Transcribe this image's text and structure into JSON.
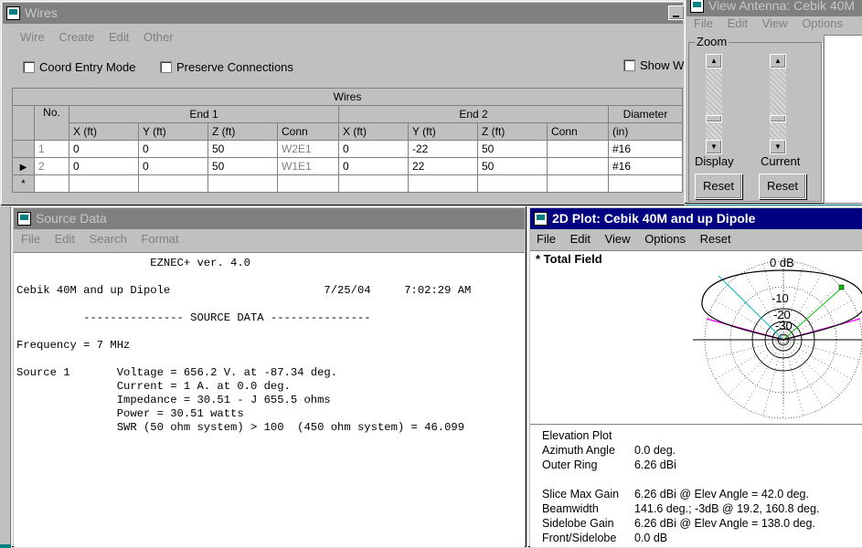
{
  "wires_window": {
    "title": "Wires",
    "menu": [
      "Wire",
      "Create",
      "Edit",
      "Other"
    ],
    "coord_entry_mode": "Coord Entry Mode",
    "preserve_connections": "Preserve Connections",
    "show_wires": "Show W",
    "table": {
      "caption": "Wires",
      "no_header": "No.",
      "end1_header": "End 1",
      "end2_header": "End 2",
      "diameter_header": "Diameter",
      "sub_headers": [
        "X  (ft)",
        "Y  (ft)",
        "Z  (ft)",
        "Conn",
        "X  (ft)",
        "Y  (ft)",
        "Z  (ft)",
        "Conn",
        "(in)"
      ],
      "rows": [
        [
          "1",
          "0",
          "0",
          "50",
          "W2E1",
          "0",
          "-22",
          "50",
          "",
          "#16"
        ],
        [
          "2",
          "0",
          "0",
          "50",
          "W1E1",
          "0",
          "22",
          "50",
          "",
          "#16"
        ]
      ],
      "new_row_marker": "*",
      "current_row_marker": "▶"
    }
  },
  "view_antenna_window": {
    "title": "View Antenna: Cebik 40M",
    "menu": [
      "File",
      "Edit",
      "View",
      "Options"
    ],
    "zoom_label": "Zoom",
    "display_label": "Display",
    "current_label": "Current",
    "reset_label": "Reset"
  },
  "source_window": {
    "title": "Source Data",
    "menu": [
      "File",
      "Edit",
      "Search",
      "Format"
    ],
    "lines": [
      "                    EZNEC+ ver. 4.0",
      "",
      "Cebik 40M and up Dipole                       7/25/04     7:02:29 AM",
      "",
      "          --------------- SOURCE DATA ---------------",
      "",
      "Frequency = 7 MHz",
      "",
      "Source 1       Voltage = 656.2 V. at -87.34 deg.",
      "               Current = 1 A. at 0.0 deg.",
      "               Impedance = 30.51 - J 655.5 ohms",
      "               Power = 30.51 watts",
      "               SWR (50 ohm system) > 100  (450 ohm system) = 46.099"
    ]
  },
  "plot_window": {
    "title": "2D Plot: Cebik 40M and up Dipole",
    "menu": [
      "File",
      "Edit",
      "View",
      "Options",
      "Reset"
    ],
    "legend": "* Total Field",
    "ring_labels": [
      "0 dB",
      "-10",
      "-20",
      "-30"
    ],
    "info": {
      "plot_type": "Elevation Plot",
      "rows1": [
        {
          "k": "Azimuth Angle",
          "v": "0.0 deg."
        },
        {
          "k": "Outer Ring",
          "v": "6.26 dBi"
        }
      ],
      "rows2": [
        {
          "k": "Slice Max Gain",
          "v": "6.26 dBi @ Elev Angle = 42.0 deg."
        },
        {
          "k": "Beamwidth",
          "v": "141.6 deg.; -3dB @ 19.2, 160.8 deg."
        },
        {
          "k": "Sidelobe Gain",
          "v": "6.26 dBi @ Elev Angle = 138.0 deg."
        },
        {
          "k": "Front/Sidelobe",
          "v": "0.0 dB"
        }
      ]
    },
    "colors": {
      "trace": "#000000",
      "beamwidth": "#ff00ff",
      "max_gain": "#00c000",
      "lobe": "#00c0c0"
    }
  }
}
